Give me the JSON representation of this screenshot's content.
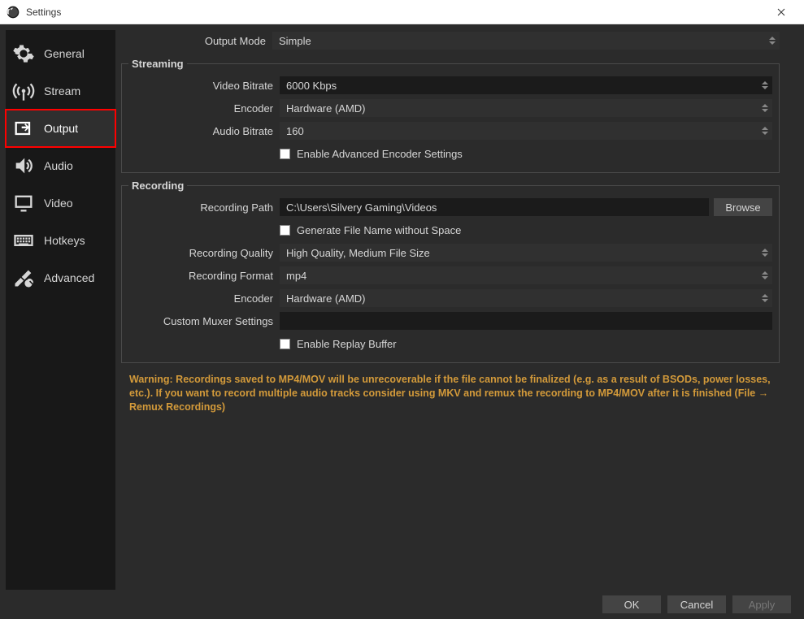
{
  "window": {
    "title": "Settings"
  },
  "sidebar": {
    "items": [
      {
        "label": "General"
      },
      {
        "label": "Stream"
      },
      {
        "label": "Output"
      },
      {
        "label": "Audio"
      },
      {
        "label": "Video"
      },
      {
        "label": "Hotkeys"
      },
      {
        "label": "Advanced"
      }
    ]
  },
  "output_mode": {
    "label": "Output Mode",
    "value": "Simple"
  },
  "streaming": {
    "legend": "Streaming",
    "video_bitrate": {
      "label": "Video Bitrate",
      "value": "6000 Kbps"
    },
    "encoder": {
      "label": "Encoder",
      "value": "Hardware (AMD)"
    },
    "audio_bitrate": {
      "label": "Audio Bitrate",
      "value": "160"
    },
    "enable_advanced": {
      "label": "Enable Advanced Encoder Settings"
    }
  },
  "recording": {
    "legend": "Recording",
    "path": {
      "label": "Recording Path",
      "value": "C:\\Users\\Silvery Gaming\\Videos",
      "browse": "Browse"
    },
    "gen_no_space": {
      "label": "Generate File Name without Space"
    },
    "quality": {
      "label": "Recording Quality",
      "value": "High Quality, Medium File Size"
    },
    "format": {
      "label": "Recording Format",
      "value": "mp4"
    },
    "encoder": {
      "label": "Encoder",
      "value": "Hardware (AMD)"
    },
    "muxer": {
      "label": "Custom Muxer Settings",
      "value": ""
    },
    "replay_buffer": {
      "label": "Enable Replay Buffer"
    }
  },
  "warning": "Warning: Recordings saved to MP4/MOV will be unrecoverable if the file cannot be finalized (e.g. as a result of BSODs, power losses, etc.). If you want to record multiple audio tracks consider using MKV and remux the recording to MP4/MOV after it is finished (File → Remux Recordings)",
  "footer": {
    "ok": "OK",
    "cancel": "Cancel",
    "apply": "Apply"
  }
}
